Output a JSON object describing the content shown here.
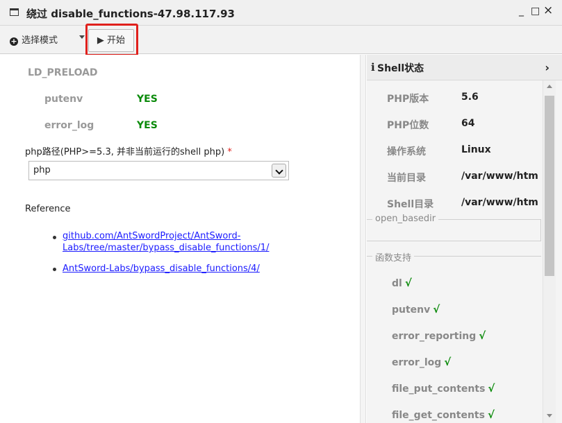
{
  "window": {
    "title": "绕过 disable_functions-47.98.117.93",
    "minimize": "_",
    "maximize": "□",
    "close": "×"
  },
  "toolbar": {
    "mode_label": "选择模式",
    "start_label": "▶ 开始"
  },
  "left": {
    "section_title": "LD_PRELOAD",
    "checks": [
      {
        "key": "putenv",
        "value": "YES"
      },
      {
        "key": "error_log",
        "value": "YES"
      }
    ],
    "php_path_label": "php路径(PHP>=5.3, 并非当前运行的shell php)",
    "required_mark": "*",
    "php_select_value": "php",
    "reference_title": "Reference",
    "references": [
      "github.com/AntSwordProject/AntSword-Labs/tree/master/bypass_disable_functions/1/",
      "AntSword-Labs/bypass_disable_functions/4/"
    ]
  },
  "right": {
    "icon": "info-icon",
    "title": "Shell状态",
    "info": [
      {
        "key": "PHP版本",
        "value": "5.6"
      },
      {
        "key": "PHP位数",
        "value": "64"
      },
      {
        "key": "操作系统",
        "value": "Linux"
      },
      {
        "key": "当前目录",
        "value": "/var/www/htm"
      },
      {
        "key": "Shell目录",
        "value": "/var/www/htm"
      }
    ],
    "open_basedir_legend": "open_basedir",
    "functions_legend": "函数支持",
    "check_mark": "√",
    "functions": [
      "dl",
      "putenv",
      "error_reporting",
      "error_log",
      "file_put_contents",
      "file_get_contents"
    ]
  },
  "colors": {
    "yes_green": "#0a8a0a",
    "link_blue": "#1a1aff",
    "highlight_red": "#e0201c"
  }
}
